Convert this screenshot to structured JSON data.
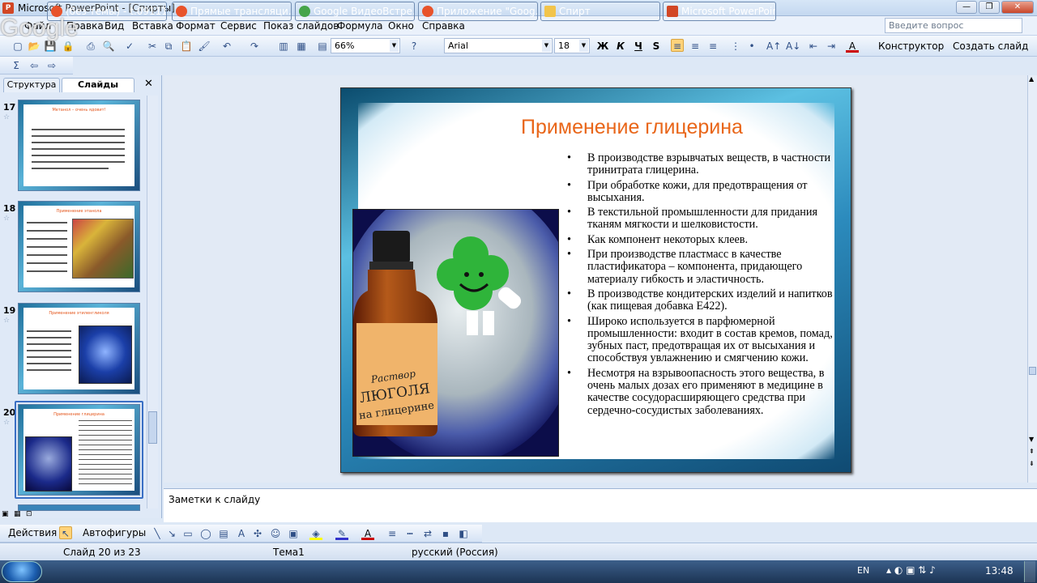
{
  "window": {
    "title": "Microsoft PowerPoint - [Спирты]",
    "app_icon_label": "P"
  },
  "watermark": "Google",
  "menu": [
    "Файл",
    "Правка",
    "Вид",
    "Вставка",
    "Формат",
    "Сервис",
    "Показ слайдов",
    "Формула",
    "Окно",
    "Справка"
  ],
  "help_search": {
    "placeholder": "Введите вопрос"
  },
  "toolbar": {
    "zoom": "66%",
    "font": "Arial",
    "font_size": "18",
    "bold": "Ж",
    "italic": "К",
    "underline": "Ч",
    "shadow": "S",
    "designer": "Конструктор",
    "new_slide": "Создать слайд"
  },
  "panel": {
    "tab_outline": "Структура",
    "tab_slides": "Слайды"
  },
  "thumbnails": [
    {
      "num": "17",
      "title": "Метанол – очень ядовит!"
    },
    {
      "num": "18",
      "title": "Применение этанола"
    },
    {
      "num": "19",
      "title": "Применение этиленгликоля"
    },
    {
      "num": "20",
      "title": "Применение глицерина"
    }
  ],
  "slide": {
    "title": "Применение глицерина",
    "bullets": [
      "В производстве взрывчатых веществ, в частности тринитрата глицерина.",
      "При обработке кожи, для предотвращения от высыхания.",
      "В текстильной промышленности для придания тканям мягкости и шелковистости.",
      "Как компонент некоторых клеев.",
      " При производстве пластмасс в качестве пластификатора – компонента, придающего материалу гибкость и эластичность.",
      "В производстве кондитерских изделий и напитков (как пищевая добавка Е422).",
      "Широко используется в парфюмерной промышленности: входит в состав кремов, помад, зубных паст, предотвращая их от высыхания и способствуя увлажнению и смягчению кожи.",
      "Несмотря на взрывоопасность этого вещества, в очень малых дозах его применяют в медицине в качестве сосудорасширяющего средства при сердечно-сосудистых заболеваниях."
    ],
    "bottle_label": "Раствор ЛЮГОЛЯ на глицерине"
  },
  "notes": {
    "placeholder": "Заметки к слайду"
  },
  "draw_toolbar": {
    "actions": "Действия",
    "autoshapes": "Автофигуры"
  },
  "status": {
    "slide": "Слайд 20 из 23",
    "theme": "Тема1",
    "language": "русский (Россия)"
  },
  "taskbar": {
    "items": [
      {
        "label": "(без темы) - t.09111...",
        "color": "#e8532b"
      },
      {
        "label": "Прямые трансляци...",
        "color": "#e8532b"
      },
      {
        "label": "Google ВидеоВстре...",
        "color": "#46a54a"
      },
      {
        "label": "Приложение \"Goog...",
        "color": "#e8532b"
      },
      {
        "label": "Спирт",
        "color": "#f2c44b"
      },
      {
        "label": "Microsoft PowerPoin...",
        "color": "#d24726"
      }
    ],
    "lang": "EN",
    "time": "13:48"
  }
}
